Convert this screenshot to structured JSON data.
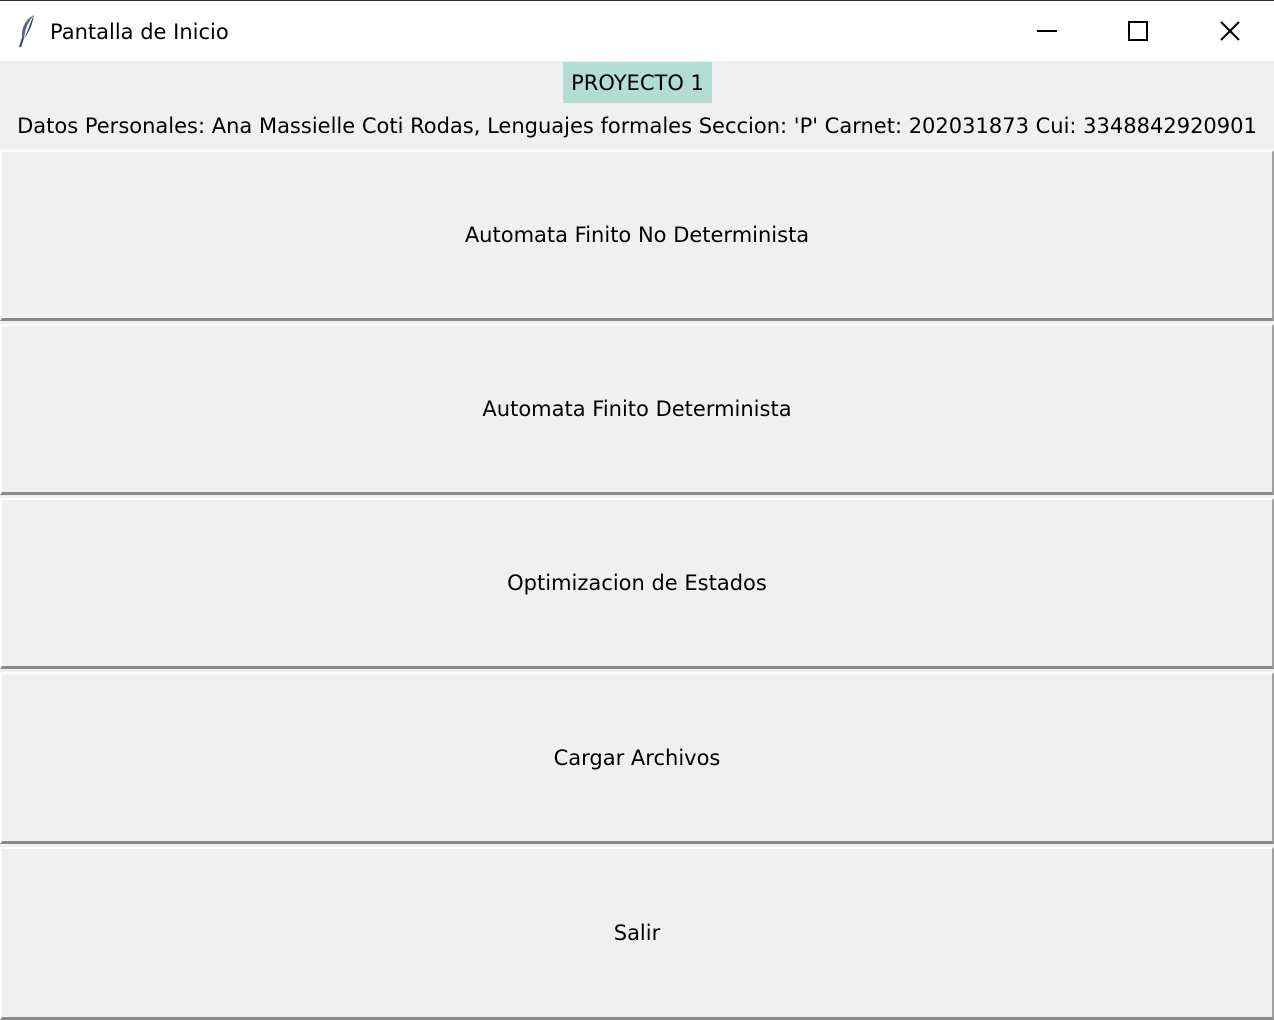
{
  "window": {
    "title": "Pantalla de Inicio",
    "icon": "feather-icon"
  },
  "header": {
    "title": "PROYECTO 1",
    "title_bg": "#b3dcd3",
    "info": "Datos Personales: Ana Massielle Coti Rodas, Lenguajes formales Seccion: 'P' Carnet: 202031873 Cui: 3348842920901"
  },
  "menu": {
    "afnd": "Automata Finito No Determinista",
    "afd": "Automata Finito Determinista",
    "optimizacion": "Optimizacion de Estados",
    "cargar": "Cargar Archivos",
    "salir": "Salir"
  }
}
